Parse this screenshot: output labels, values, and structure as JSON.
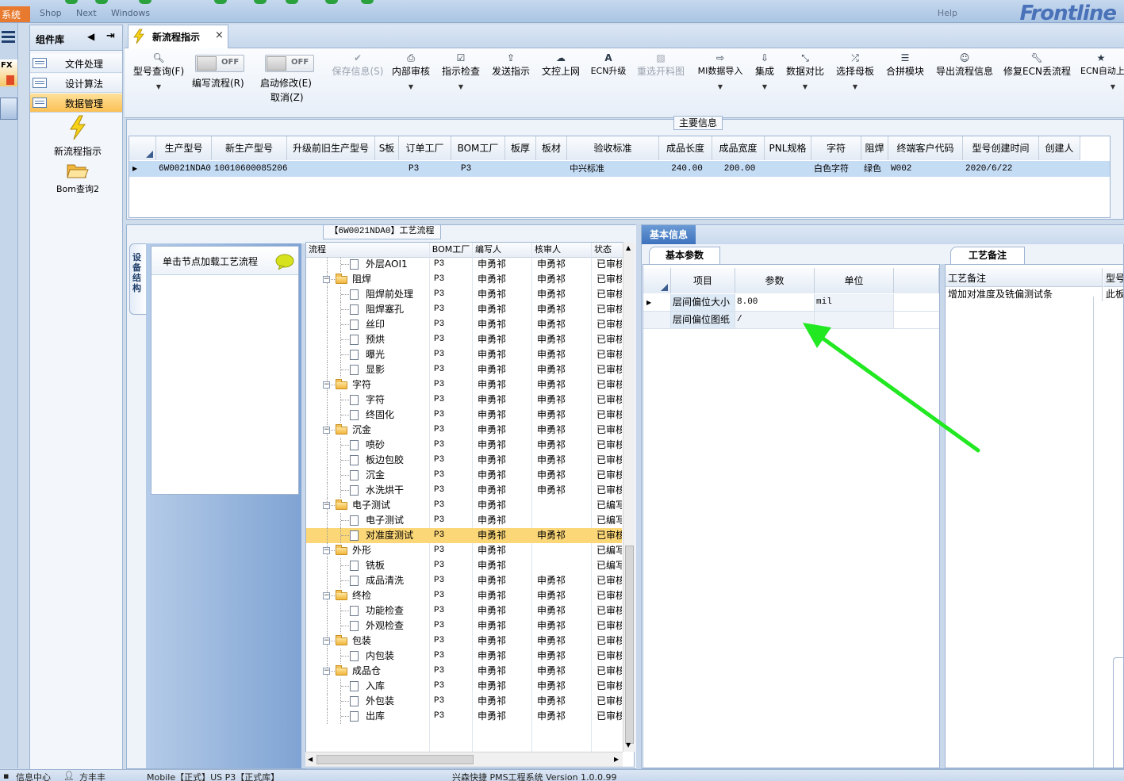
{
  "app": {
    "system_label": "系统",
    "menu": [
      "Shop",
      "Next",
      "Windows"
    ],
    "help": "Help",
    "brand": "Frontline"
  },
  "left_strip": {
    "menu_icon": "hamburger-icon"
  },
  "component_library": {
    "title": "组件库",
    "items": [
      {
        "label": "文件处理",
        "selected": false
      },
      {
        "label": "设计算法",
        "selected": false
      },
      {
        "label": "数据管理",
        "selected": true
      }
    ],
    "tools": [
      {
        "label": "新流程指示",
        "icon": "lightning-icon"
      },
      {
        "label": "Bom查询2",
        "icon": "folder-open-icon"
      }
    ]
  },
  "tabs": [
    {
      "label": "新流程指示",
      "close": "×"
    }
  ],
  "ribbon": {
    "buttons": [
      {
        "label": "型号查询(F)",
        "icon": "search-icon",
        "dropdown": true,
        "disabled": false
      },
      {
        "label": "编写流程(R)",
        "toggle": "OFF"
      },
      {
        "label": "启动修改(E)",
        "toggle": "OFF",
        "sublabel": "取消(Z)"
      },
      {
        "label": "保存信息(S)",
        "icon": "check-icon",
        "disabled": true
      },
      {
        "label": "内部审核",
        "icon": "print-icon",
        "dropdown": true
      },
      {
        "label": "指示检查",
        "icon": "checkbox-icon",
        "dropdown": true
      },
      {
        "label": "发送指示",
        "icon": "upload-icon"
      },
      {
        "label": "文控上网",
        "icon": "cloud-upload-icon"
      },
      {
        "label": "ECN升级",
        "icon": "font-icon"
      },
      {
        "label": "重选开料图",
        "icon": "image-icon",
        "disabled": true
      },
      {
        "label": "MI数据导入",
        "icon": "sign-in-icon",
        "dropdown": true
      },
      {
        "label": "集成",
        "icon": "download-icon",
        "dropdown": true
      },
      {
        "label": "数据对比",
        "icon": "compress-icon",
        "dropdown": true
      },
      {
        "label": "选择母板",
        "icon": "shuffle-icon",
        "dropdown": true
      },
      {
        "label": "合拼模块",
        "icon": "list-icon"
      },
      {
        "label": "导出流程信息",
        "icon": "smile-icon"
      },
      {
        "label": "修复ECN丢流程",
        "icon": "wrench-icon"
      },
      {
        "label": "ECN自动上",
        "icon": "star-icon",
        "dropdown": true
      }
    ]
  },
  "main_info": {
    "title": "主要信息",
    "columns": [
      "生产型号",
      "新生产型号",
      "升级前旧生产型号",
      "S板",
      "订单工厂",
      "BOM工厂",
      "板厚",
      "板材",
      "验收标准",
      "成品长度",
      "成品宽度",
      "PNL规格",
      "字符",
      "阻焊",
      "终端客户代码",
      "型号创建时间",
      "创建人"
    ],
    "row": [
      "6W0021NDA0",
      "10010600085206",
      "",
      "",
      "P3",
      "P3",
      "",
      "",
      "中兴标准",
      "240.00",
      "200.00",
      "",
      "白色字符",
      "绿色",
      "W002",
      "2020/6/22",
      ""
    ]
  },
  "process": {
    "title": "【6W0021NDA0】工艺流程",
    "vtab_label": "设备结构",
    "hint": "单击节点加载工艺流程",
    "columns": [
      "流程",
      "BOM工厂",
      "编写人",
      "核审人",
      "状态"
    ],
    "rows": [
      {
        "name": "外层AOI1",
        "level": 1,
        "bom": "P3",
        "writer": "申勇祁",
        "reviewer": "申勇祁",
        "status": "已审核"
      },
      {
        "name": "阻焊",
        "level": 0,
        "bom": "P3",
        "writer": "申勇祁",
        "reviewer": "申勇祁",
        "status": "已审核"
      },
      {
        "name": "阻焊前处理",
        "level": 1,
        "bom": "P3",
        "writer": "申勇祁",
        "reviewer": "申勇祁",
        "status": "已审核"
      },
      {
        "name": "阻焊塞孔",
        "level": 1,
        "bom": "P3",
        "writer": "申勇祁",
        "reviewer": "申勇祁",
        "status": "已审核"
      },
      {
        "name": "丝印",
        "level": 1,
        "bom": "P3",
        "writer": "申勇祁",
        "reviewer": "申勇祁",
        "status": "已审核"
      },
      {
        "name": "预烘",
        "level": 1,
        "bom": "P3",
        "writer": "申勇祁",
        "reviewer": "申勇祁",
        "status": "已审核"
      },
      {
        "name": "曝光",
        "level": 1,
        "bom": "P3",
        "writer": "申勇祁",
        "reviewer": "申勇祁",
        "status": "已审核"
      },
      {
        "name": "显影",
        "level": 1,
        "bom": "P3",
        "writer": "申勇祁",
        "reviewer": "申勇祁",
        "status": "已审核"
      },
      {
        "name": "字符",
        "level": 0,
        "bom": "P3",
        "writer": "申勇祁",
        "reviewer": "申勇祁",
        "status": "已审核"
      },
      {
        "name": "字符",
        "level": 1,
        "bom": "P3",
        "writer": "申勇祁",
        "reviewer": "申勇祁",
        "status": "已审核"
      },
      {
        "name": "终固化",
        "level": 1,
        "bom": "P3",
        "writer": "申勇祁",
        "reviewer": "申勇祁",
        "status": "已审核"
      },
      {
        "name": "沉金",
        "level": 0,
        "bom": "P3",
        "writer": "申勇祁",
        "reviewer": "申勇祁",
        "status": "已审核"
      },
      {
        "name": "喷砂",
        "level": 1,
        "bom": "P3",
        "writer": "申勇祁",
        "reviewer": "申勇祁",
        "status": "已审核"
      },
      {
        "name": "板边包胶",
        "level": 1,
        "bom": "P3",
        "writer": "申勇祁",
        "reviewer": "申勇祁",
        "status": "已审核"
      },
      {
        "name": "沉金",
        "level": 1,
        "bom": "P3",
        "writer": "申勇祁",
        "reviewer": "申勇祁",
        "status": "已审核"
      },
      {
        "name": "水洗烘干",
        "level": 1,
        "bom": "P3",
        "writer": "申勇祁",
        "reviewer": "申勇祁",
        "status": "已审核"
      },
      {
        "name": "电子测试",
        "level": 0,
        "bom": "P3",
        "writer": "申勇祁",
        "reviewer": "",
        "status": "已编写"
      },
      {
        "name": "电子测试",
        "level": 1,
        "bom": "P3",
        "writer": "申勇祁",
        "reviewer": "",
        "status": "已编写"
      },
      {
        "name": "对准度测试",
        "level": 1,
        "bom": "P3",
        "writer": "申勇祁",
        "reviewer": "申勇祁",
        "status": "已审核",
        "selected": true
      },
      {
        "name": "外形",
        "level": 0,
        "bom": "P3",
        "writer": "申勇祁",
        "reviewer": "",
        "status": "已编写"
      },
      {
        "name": "铣板",
        "level": 1,
        "bom": "P3",
        "writer": "申勇祁",
        "reviewer": "",
        "status": "已编写"
      },
      {
        "name": "成品清洗",
        "level": 1,
        "bom": "P3",
        "writer": "申勇祁",
        "reviewer": "申勇祁",
        "status": "已审核"
      },
      {
        "name": "终检",
        "level": 0,
        "bom": "P3",
        "writer": "申勇祁",
        "reviewer": "申勇祁",
        "status": "已审核"
      },
      {
        "name": "功能检查",
        "level": 1,
        "bom": "P3",
        "writer": "申勇祁",
        "reviewer": "申勇祁",
        "status": "已审核"
      },
      {
        "name": "外观检查",
        "level": 1,
        "bom": "P3",
        "writer": "申勇祁",
        "reviewer": "申勇祁",
        "status": "已审核"
      },
      {
        "name": "包装",
        "level": 0,
        "bom": "P3",
        "writer": "申勇祁",
        "reviewer": "申勇祁",
        "status": "已审核"
      },
      {
        "name": "内包装",
        "level": 1,
        "bom": "P3",
        "writer": "申勇祁",
        "reviewer": "申勇祁",
        "status": "已审核"
      },
      {
        "name": "成品仓",
        "level": 0,
        "bom": "P3",
        "writer": "申勇祁",
        "reviewer": "申勇祁",
        "status": "已审核"
      },
      {
        "name": "入库",
        "level": 1,
        "bom": "P3",
        "writer": "申勇祁",
        "reviewer": "申勇祁",
        "status": "已审核"
      },
      {
        "name": "外包装",
        "level": 1,
        "bom": "P3",
        "writer": "申勇祁",
        "reviewer": "申勇祁",
        "status": "已审核"
      },
      {
        "name": "出库",
        "level": 1,
        "bom": "P3",
        "writer": "申勇祁",
        "reviewer": "申勇祁",
        "status": "已审核"
      }
    ]
  },
  "basic_info": {
    "tab": "基本信息",
    "params_tab": "基本参数",
    "columns": [
      "项目",
      "参数",
      "单位"
    ],
    "rows": [
      {
        "item": "层间偏位大小",
        "param": "8.00",
        "unit": "mil"
      },
      {
        "item": "层间偏位图纸",
        "param": "/",
        "unit": ""
      }
    ],
    "annotation_color": "#22e822"
  },
  "remarks": {
    "tab": "工艺备注",
    "columns": [
      "工艺备注",
      "型号"
    ],
    "rows": [
      {
        "remark": "增加对准度及铣偏测试条",
        "model": "此板"
      }
    ]
  },
  "status_bar": {
    "items": [
      "信息中心",
      "方丰丰",
      "Mobile【正式】US P3【正式库】",
      "兴森快捷 PMS工程系统 Version 1.0.0.99"
    ]
  }
}
